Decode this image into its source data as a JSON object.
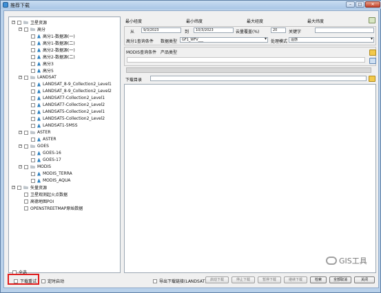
{
  "window": {
    "title": "推荐下载",
    "buttons": {
      "minimize": "–",
      "maximize": "□",
      "close": "✕"
    }
  },
  "tree": {
    "nodes": [
      {
        "label": "卫星资源",
        "level": 0,
        "type": "folder",
        "expander": "−"
      },
      {
        "label": "高分",
        "level": 1,
        "type": "folder",
        "expander": "−"
      },
      {
        "label": "高分1-数据源(一)",
        "level": 2,
        "type": "leaf"
      },
      {
        "label": "高分1-数据源(二)",
        "level": 2,
        "type": "leaf"
      },
      {
        "label": "高分2-数据源(一)",
        "level": 2,
        "type": "leaf"
      },
      {
        "label": "高分2-数据源(二)",
        "level": 2,
        "type": "leaf"
      },
      {
        "label": "高分3",
        "level": 2,
        "type": "leaf"
      },
      {
        "label": "高分5",
        "level": 2,
        "type": "leaf"
      },
      {
        "label": "LANDSAT",
        "level": 1,
        "type": "folder",
        "expander": "−"
      },
      {
        "label": "LANDSAT_8-9_Collection2_Level1",
        "level": 2,
        "type": "leaf"
      },
      {
        "label": "LANDSAT_8-9_Collection2_Level2",
        "level": 2,
        "type": "leaf"
      },
      {
        "label": "LANDSAT7-Collection2_Level1",
        "level": 2,
        "type": "leaf"
      },
      {
        "label": "LANDSAT7-Collection2_Level2",
        "level": 2,
        "type": "leaf"
      },
      {
        "label": "LANDSAT5-Collection2_Level1",
        "level": 2,
        "type": "leaf"
      },
      {
        "label": "LANDSAT5-Collection2_Level2",
        "level": 2,
        "type": "leaf"
      },
      {
        "label": "LANDSAT1-5MSS",
        "level": 2,
        "type": "leaf"
      },
      {
        "label": "ASTER",
        "level": 1,
        "type": "folder",
        "expander": "−"
      },
      {
        "label": "ASTER",
        "level": 2,
        "type": "leaf"
      },
      {
        "label": "GOES",
        "level": 1,
        "type": "folder",
        "expander": "−"
      },
      {
        "label": "GOES-16",
        "level": 2,
        "type": "leaf"
      },
      {
        "label": "GOES-17",
        "level": 2,
        "type": "leaf"
      },
      {
        "label": "MODIS",
        "level": 1,
        "type": "folder",
        "expander": "−"
      },
      {
        "label": "MODIS_TERRA",
        "level": 2,
        "type": "leaf"
      },
      {
        "label": "MODIS_AQUA",
        "level": 2,
        "type": "leaf"
      },
      {
        "label": "矢量资源",
        "level": 0,
        "type": "folder",
        "expander": "−"
      },
      {
        "label": "卫星观测起火点数据",
        "level": 1,
        "type": "leaf-plain"
      },
      {
        "label": "高德地图POI",
        "level": 1,
        "type": "leaf-plain"
      },
      {
        "label": "OPENSTREETMAP原始数据",
        "level": 1,
        "type": "leaf-plain"
      }
    ],
    "select_all_label": "全选"
  },
  "extent": {
    "min_lon": "最小经度",
    "min_lat": "最小纬度",
    "max_lon": "最大经度",
    "max_lat": "最大纬度"
  },
  "query": {
    "from_label": "从",
    "from_date": "9/3/2023",
    "to_label": "到",
    "to_date": "10/3/2023",
    "cloud_label": "云量覆盖(%)",
    "cloud_value": "20",
    "keyword_label": "关键字",
    "keyword_value": "",
    "gf_label": "高分1查询条件",
    "data_type_label": "数据类型",
    "data_type_value": "GF1_WFV___",
    "process_label": "处理模式",
    "process_value": "遥感",
    "modis_label": "MODIS查询条件",
    "product_type_label": "产品类型",
    "product_type_value": ""
  },
  "download": {
    "dir_label": "下载目录",
    "dir_value": "",
    "progress": 0
  },
  "bottom": {
    "retry_label": "下载重试",
    "timer_label": "定时启动",
    "export_label": "导出下载链接(LANDSAT)",
    "start_label": "启动下载",
    "stop_label": "停止下载",
    "pause_label": "暂停下载",
    "resume_label": "继续下载",
    "search_label": "检索",
    "cancel_all_label": "全部取消",
    "close_label": "关闭"
  },
  "watermark": {
    "text": "GIS工具"
  }
}
